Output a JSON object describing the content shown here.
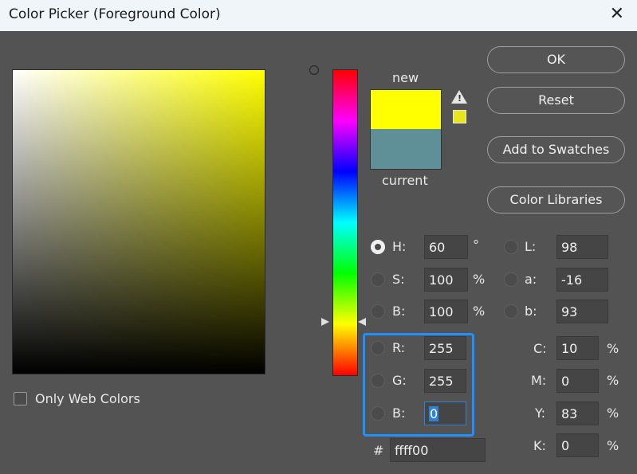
{
  "window": {
    "title": "Color Picker (Foreground Color)",
    "close_icon": "close-icon"
  },
  "preview": {
    "new_label": "new",
    "current_label": "current",
    "new_color": "#ffff00",
    "current_color": "#5f9097"
  },
  "buttons": {
    "ok": "OK",
    "reset": "Reset",
    "add_swatches": "Add to Swatches",
    "color_libraries": "Color Libraries"
  },
  "fields": {
    "H": {
      "label": "H:",
      "value": "60",
      "unit": "°"
    },
    "S": {
      "label": "S:",
      "value": "100",
      "unit": "%"
    },
    "Bri": {
      "label": "B:",
      "value": "100",
      "unit": "%"
    },
    "R": {
      "label": "R:",
      "value": "255"
    },
    "G": {
      "label": "G:",
      "value": "255"
    },
    "Blu": {
      "label": "B:",
      "value": "0"
    },
    "L": {
      "label": "L:",
      "value": "98"
    },
    "a": {
      "label": "a:",
      "value": "-16"
    },
    "b": {
      "label": "b:",
      "value": "93"
    },
    "C": {
      "label": "C:",
      "value": "10",
      "unit": "%"
    },
    "M": {
      "label": "M:",
      "value": "0",
      "unit": "%"
    },
    "Y": {
      "label": "Y:",
      "value": "83",
      "unit": "%"
    },
    "K": {
      "label": "K:",
      "value": "0",
      "unit": "%"
    },
    "hex": {
      "label": "#",
      "value": "ffff00"
    }
  },
  "only_web_colors": {
    "label": "Only Web Colors",
    "checked": false
  },
  "selected_mode": "H"
}
